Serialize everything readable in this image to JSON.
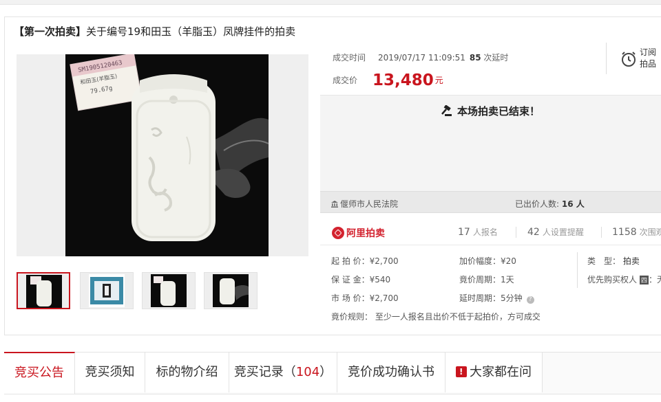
{
  "title": {
    "prefix": "【第一次拍卖】",
    "text": "关于编号19和田玉（羊脂玉）凤牌挂件的拍卖"
  },
  "product_image": {
    "tag_lines": [
      "SM1905120463",
      "和田玉(羊脂玉)",
      "79.67g"
    ],
    "thumb_count": 4,
    "active_thumb": 0
  },
  "deal": {
    "time_label": "成交时间",
    "time_value": "2019/07/17 11:09:51",
    "delay_count": "85",
    "delay_label": "次延时",
    "price_label": "成交价",
    "price_value": "13,480",
    "price_unit": "元"
  },
  "subscribe": {
    "line1": "订阅",
    "line2": "拍品",
    "icon": "alarm-clock-icon"
  },
  "ended_message": "本场拍卖已结束！",
  "court": {
    "name": "偃师市人民法院",
    "bidders_label": "已出价人数:",
    "bidders_value": "16 人"
  },
  "platform": {
    "name": "阿里拍卖",
    "stats": [
      {
        "num": "17",
        "label": "人报名"
      },
      {
        "num": "42",
        "label": "人设置提醒"
      },
      {
        "num": "1158",
        "label": "次围观"
      }
    ]
  },
  "params": {
    "start_price": {
      "label": "起 拍 价：",
      "value": "¥2,700"
    },
    "deposit": {
      "label": "保 证 金：",
      "value": "¥540"
    },
    "market_price": {
      "label": "市 场 价：",
      "value": "¥2,700"
    },
    "increment": {
      "label": "加价幅度：",
      "value": "¥20"
    },
    "bid_period": {
      "label": "竟价周期：",
      "value": "1天"
    },
    "delay_period": {
      "label": "延时周期：",
      "value": "5分钟"
    },
    "type": {
      "label": "类　型：",
      "value": "拍卖"
    },
    "priority": {
      "label": "优先购买权人",
      "value": "无"
    },
    "rule": {
      "label": "竟价规则：",
      "value": "至少一人报名且出价不低于起拍价，方可成交"
    }
  },
  "tabs": [
    {
      "label": "竞买公告"
    },
    {
      "label": "竞买须知"
    },
    {
      "label": "标的物介绍"
    },
    {
      "label": "竞买记录（",
      "count": "104",
      "suffix": "）"
    },
    {
      "label": "竞价成功确认书"
    },
    {
      "label": "大家都在问"
    }
  ],
  "colors": {
    "accent": "#c9151e",
    "ended_bg": "#f4f4f4"
  }
}
